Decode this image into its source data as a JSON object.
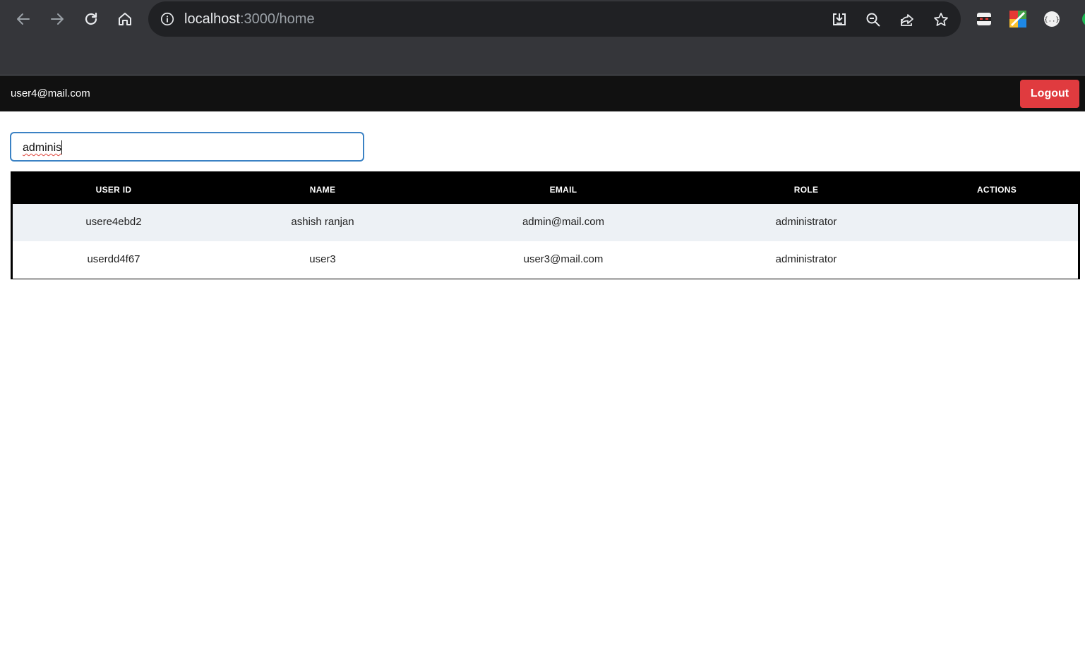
{
  "browser": {
    "url_host": "localhost",
    "url_rest": ":3000/home",
    "icons": [
      "back-icon",
      "forward-icon",
      "reload-icon",
      "home-icon",
      "info-icon",
      "install-icon",
      "zoom-icon",
      "share-icon",
      "bookmark-star-icon"
    ]
  },
  "header": {
    "user_email": "user4@mail.com",
    "logout_label": "Logout"
  },
  "search": {
    "value": "adminis"
  },
  "table": {
    "columns": [
      "USER ID",
      "NAME",
      "EMAIL",
      "ROLE",
      "ACTIONS"
    ],
    "rows": [
      {
        "user_id": "usere4ebd2",
        "name": "ashish ranjan",
        "email": "admin@mail.com",
        "role": "administrator",
        "actions": ""
      },
      {
        "user_id": "userdd4f67",
        "name": "user3",
        "email": "user3@mail.com",
        "role": "administrator",
        "actions": ""
      }
    ]
  },
  "colors": {
    "header_bg": "#111111",
    "logout_bg": "#e03b3f",
    "table_header_bg": "#000000",
    "row_alt_bg": "#edf1f5",
    "search_border": "#3b82c4"
  }
}
